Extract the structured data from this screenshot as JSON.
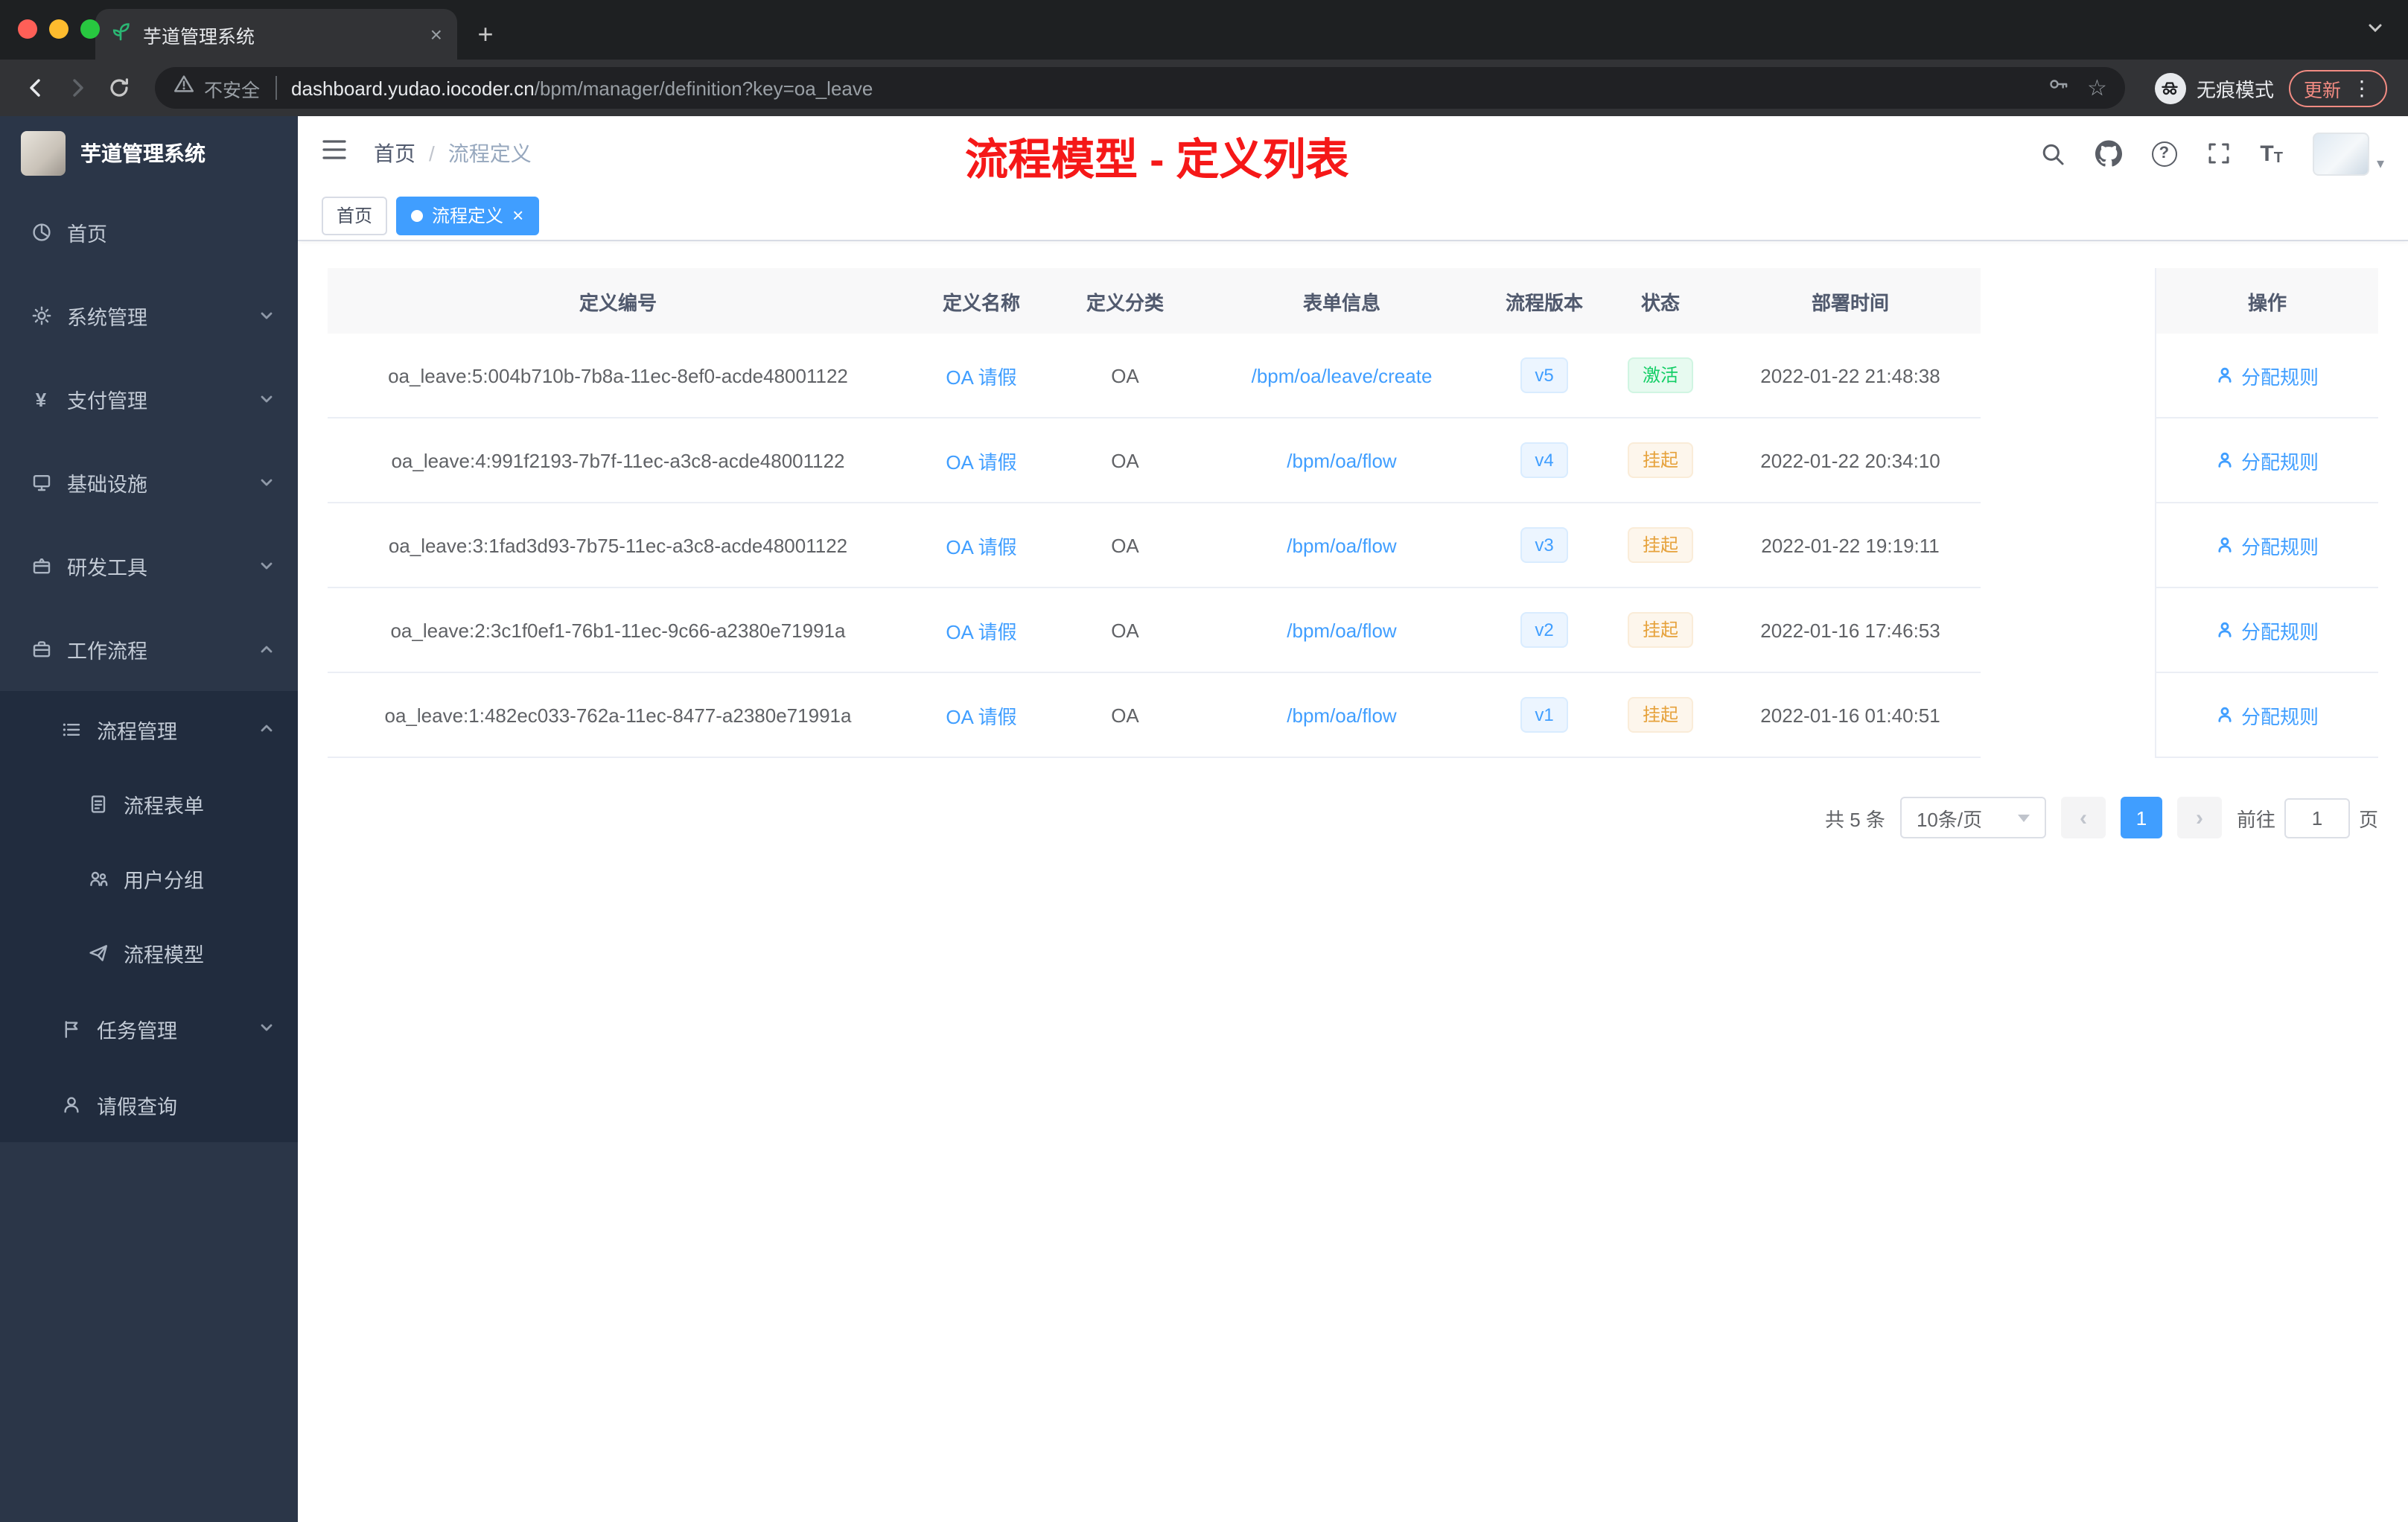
{
  "colors": {
    "accent": "#409eff",
    "annotation_red": "#f51818",
    "success_green": "#13ce66",
    "warning_orange": "#e6a23c",
    "sidebar_bg": "#2b3648",
    "submenu_bg": "#212c3e"
  },
  "browser": {
    "tab_title": "芋道管理系统",
    "close_glyph": "×",
    "new_tab_glyph": "+",
    "security_label": "不安全",
    "url_host": "dashboard.yudao.iocoder.cn",
    "url_path": "/bpm/manager/definition?key=oa_leave",
    "star_glyph": "☆",
    "incognito_label": "无痕模式",
    "update_label": "更新",
    "menu_glyph": "⋮"
  },
  "sidebar": {
    "logo_title": "芋道管理系统",
    "items": [
      {
        "label": "首页"
      },
      {
        "label": "系统管理"
      },
      {
        "label": "支付管理"
      },
      {
        "label": "基础设施"
      },
      {
        "label": "研发工具"
      },
      {
        "label": "工作流程"
      },
      {
        "label": "流程管理"
      },
      {
        "label": "流程表单"
      },
      {
        "label": "用户分组"
      },
      {
        "label": "流程模型"
      },
      {
        "label": "任务管理"
      },
      {
        "label": "请假查询"
      }
    ],
    "yen_glyph": "¥"
  },
  "navbar": {
    "breadcrumb_home": "首页",
    "breadcrumb_separator": "/",
    "breadcrumb_current": "流程定义",
    "fontsize_big": "T",
    "fontsize_small": "T",
    "avatar_caret": "▾",
    "help_glyph": "?"
  },
  "annotation": {
    "title": "流程模型 - 定义列表"
  },
  "tags": [
    {
      "label": "首页"
    },
    {
      "label": "流程定义",
      "close_glyph": "×"
    }
  ],
  "table": {
    "headers": [
      "定义编号",
      "定义名称",
      "定义分类",
      "表单信息",
      "流程版本",
      "状态",
      "部署时间",
      "操作"
    ],
    "rows": [
      {
        "id": "oa_leave:5:004b710b-7b8a-11ec-8ef0-acde48001122",
        "name": "OA 请假",
        "category": "OA",
        "form": "/bpm/oa/leave/create",
        "version": "v5",
        "status": "激活",
        "status_class": "tag-success",
        "time": "2022-01-22 21:48:38",
        "action": "分配规则"
      },
      {
        "id": "oa_leave:4:991f2193-7b7f-11ec-a3c8-acde48001122",
        "name": "OA 请假",
        "category": "OA",
        "form": "/bpm/oa/flow",
        "version": "v4",
        "status": "挂起",
        "status_class": "tag-warning",
        "time": "2022-01-22 20:34:10",
        "action": "分配规则"
      },
      {
        "id": "oa_leave:3:1fad3d93-7b75-11ec-a3c8-acde48001122",
        "name": "OA 请假",
        "category": "OA",
        "form": "/bpm/oa/flow",
        "version": "v3",
        "status": "挂起",
        "status_class": "tag-warning",
        "time": "2022-01-22 19:19:11",
        "action": "分配规则"
      },
      {
        "id": "oa_leave:2:3c1f0ef1-76b1-11ec-9c66-a2380e71991a",
        "name": "OA 请假",
        "category": "OA",
        "form": "/bpm/oa/flow",
        "version": "v2",
        "status": "挂起",
        "status_class": "tag-warning",
        "time": "2022-01-16 17:46:53",
        "action": "分配规则"
      },
      {
        "id": "oa_leave:1:482ec033-762a-11ec-8477-a2380e71991a",
        "name": "OA 请假",
        "category": "OA",
        "form": "/bpm/oa/flow",
        "version": "v1",
        "status": "挂起",
        "status_class": "tag-warning",
        "time": "2022-01-16 01:40:51",
        "action": "分配规则"
      }
    ]
  },
  "pagination": {
    "total": "共 5 条",
    "page_size": "10条/页",
    "prev_glyph": "‹",
    "next_glyph": "›",
    "current_page": "1",
    "goto_label": "前往",
    "goto_value": "1",
    "page_unit": "页"
  }
}
